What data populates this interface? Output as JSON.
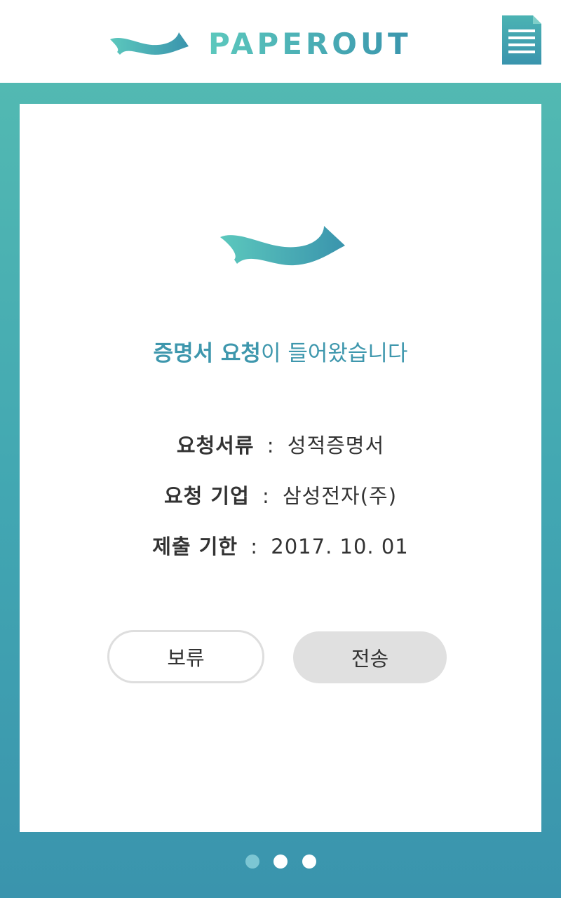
{
  "header": {
    "brand_name": "PAPEROUT",
    "logo_icon": "paper-wave-icon",
    "menu_icon": "document-menu-icon"
  },
  "notice": {
    "headline_strong": "증명서 요청",
    "headline_rest": "이 들어왔습니다"
  },
  "details": [
    {
      "label": "요청서류",
      "separator": ":",
      "value": "성적증명서"
    },
    {
      "label": "요청 기업",
      "separator": ":",
      "value": "삼성전자(주)"
    },
    {
      "label": "제출 기한",
      "separator": ":",
      "value": "2017. 10. 01"
    }
  ],
  "actions": {
    "hold_label": "보류",
    "send_label": "전송"
  },
  "pager": {
    "total_pages": 3,
    "current_page": 1
  },
  "colors": {
    "accent": "#3e97ad",
    "gradient_start": "#5cc8bd",
    "gradient_end": "#3a94ad",
    "button_gray": "#e0e0e0",
    "dot_active": "#7cc6d3"
  }
}
